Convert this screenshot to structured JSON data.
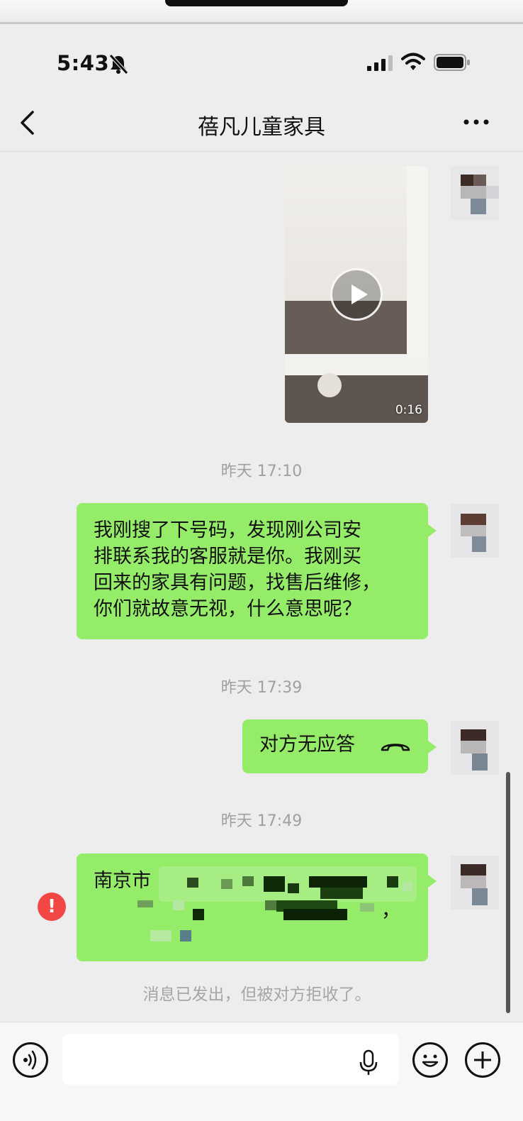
{
  "status": {
    "time": "5:43"
  },
  "chat": {
    "title": "蓓凡儿童家具"
  },
  "messages": [
    {
      "type": "video",
      "duration": "0:16"
    },
    {
      "type": "timestamp",
      "text": "昨天 17:10"
    },
    {
      "type": "text",
      "lines": [
        "我刚搜了下号码，发现刚公司安",
        "排联系我的客服就是你。我刚买",
        "回来的家具有问题，找售后维修，",
        "你们就故意无视，什么意思呢？"
      ]
    },
    {
      "type": "timestamp",
      "text": "昨天 17:39"
    },
    {
      "type": "call",
      "text": "对方无应答"
    },
    {
      "type": "timestamp",
      "text": "昨天 17:49"
    },
    {
      "type": "address",
      "visible_text": "南京市",
      "trailing": "，",
      "status": "failed"
    }
  ],
  "notice": "消息已发出，但被对方拒收了。",
  "error_mark": "!",
  "colors": {
    "bubble_green": "#95ec69",
    "background": "#ededed",
    "error_red": "#f24744"
  },
  "icons": [
    "back-icon",
    "more-icon",
    "play-icon",
    "hangup-icon",
    "voice-icon",
    "mic-icon",
    "emoji-icon",
    "plus-icon"
  ]
}
